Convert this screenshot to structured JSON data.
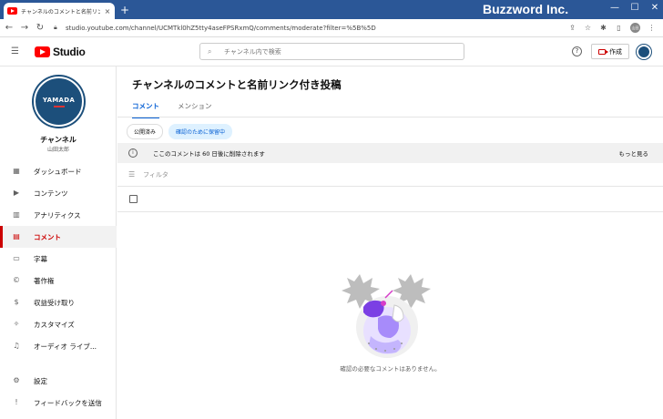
{
  "browser": {
    "tab_title": "チャンネルのコメントと名前リンク付き...",
    "tab_close": "×",
    "new_tab": "+",
    "window_title": "Buzzword Inc.",
    "minimize": "—",
    "maximize": "☐",
    "close": "✕",
    "url": "studio.youtube.com/channel/UCMTkl0hZ5tty4aseFPSRxmQ/comments/moderate?filter=%5B%5D",
    "profile_initials": "山田"
  },
  "header": {
    "logo_text": "Studio",
    "search_placeholder": "チャンネル内で検索",
    "help_glyph": "?",
    "create_label": "作成"
  },
  "sidebar": {
    "avatar_text": "YAMADA",
    "channel_label": "チャンネル",
    "channel_owner": "山田太郎",
    "items": [
      {
        "label": "ダッシュボード",
        "icon": "dashboard-icon",
        "glyph": "▦"
      },
      {
        "label": "コンテンツ",
        "icon": "content-icon",
        "glyph": "▶"
      },
      {
        "label": "アナリティクス",
        "icon": "analytics-icon",
        "glyph": "▥"
      },
      {
        "label": "コメント",
        "icon": "comments-icon",
        "glyph": "▤",
        "active": true
      },
      {
        "label": "字幕",
        "icon": "subtitles-icon",
        "glyph": "▭"
      },
      {
        "label": "著作権",
        "icon": "copyright-icon",
        "glyph": "©"
      },
      {
        "label": "収益受け取り",
        "icon": "monetization-icon",
        "glyph": "$"
      },
      {
        "label": "カスタマイズ",
        "icon": "customize-icon",
        "glyph": "✧"
      },
      {
        "label": "オーディオ ライブ...",
        "icon": "audio-library-icon",
        "glyph": "♫"
      }
    ],
    "bottom_items": [
      {
        "label": "設定",
        "icon": "settings-icon",
        "glyph": "⚙"
      },
      {
        "label": "フィードバックを送信",
        "icon": "feedback-icon",
        "glyph": "!"
      }
    ]
  },
  "main": {
    "title": "チャンネルのコメントと名前リンク付き投稿",
    "tabs": [
      {
        "label": "コメント",
        "active": true
      },
      {
        "label": "メンション",
        "active": false
      }
    ],
    "chips": [
      {
        "label": "公開済み",
        "active": false
      },
      {
        "label": "確認のために保留中",
        "active": true
      }
    ],
    "notice_text": "ここのコメントは 60 日後に削除されます",
    "notice_more": "もっと見る",
    "info_glyph": "i",
    "filter_placeholder": "フィルタ",
    "empty_message": "確認の必要なコメントはありません。"
  },
  "colors": {
    "chrome_blue": "#2b5797",
    "accent_red": "#cc0000",
    "link_blue": "#065fd4",
    "illust_purple": "#7b3fe4"
  }
}
